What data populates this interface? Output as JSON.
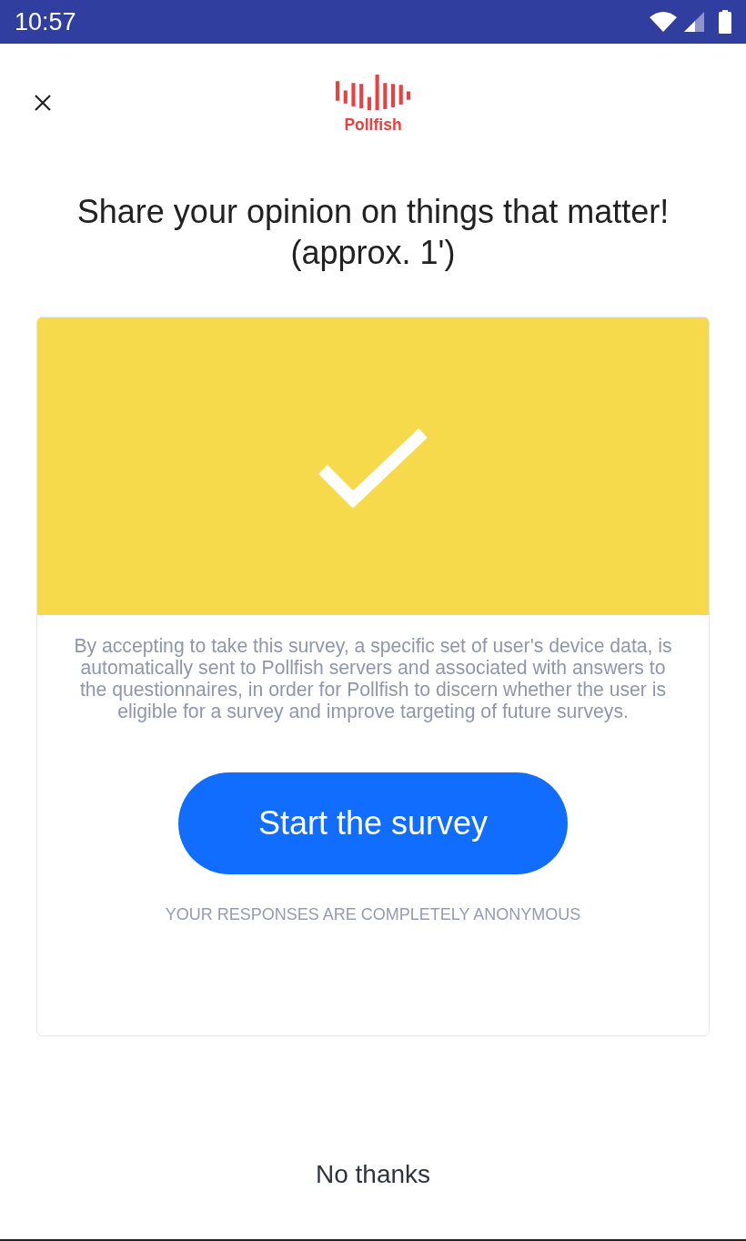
{
  "status_bar": {
    "time": "10:57"
  },
  "header": {
    "logo_text": "Pollfish"
  },
  "title": "Share your opinion on things that matter! (approx. 1')",
  "card": {
    "disclaimer": "By accepting to take this survey, a specific set of user's device data, is automatically sent to Pollfish servers and associated with answers to the questionnaires, in order for Pollfish to discern whether the user is eligible for a survey and improve targeting of future surveys.",
    "start_button": "Start the survey",
    "anonymity_note": "YOUR RESPONSES ARE COMPLETELY ANONYMOUS"
  },
  "decline_button": "No thanks"
}
